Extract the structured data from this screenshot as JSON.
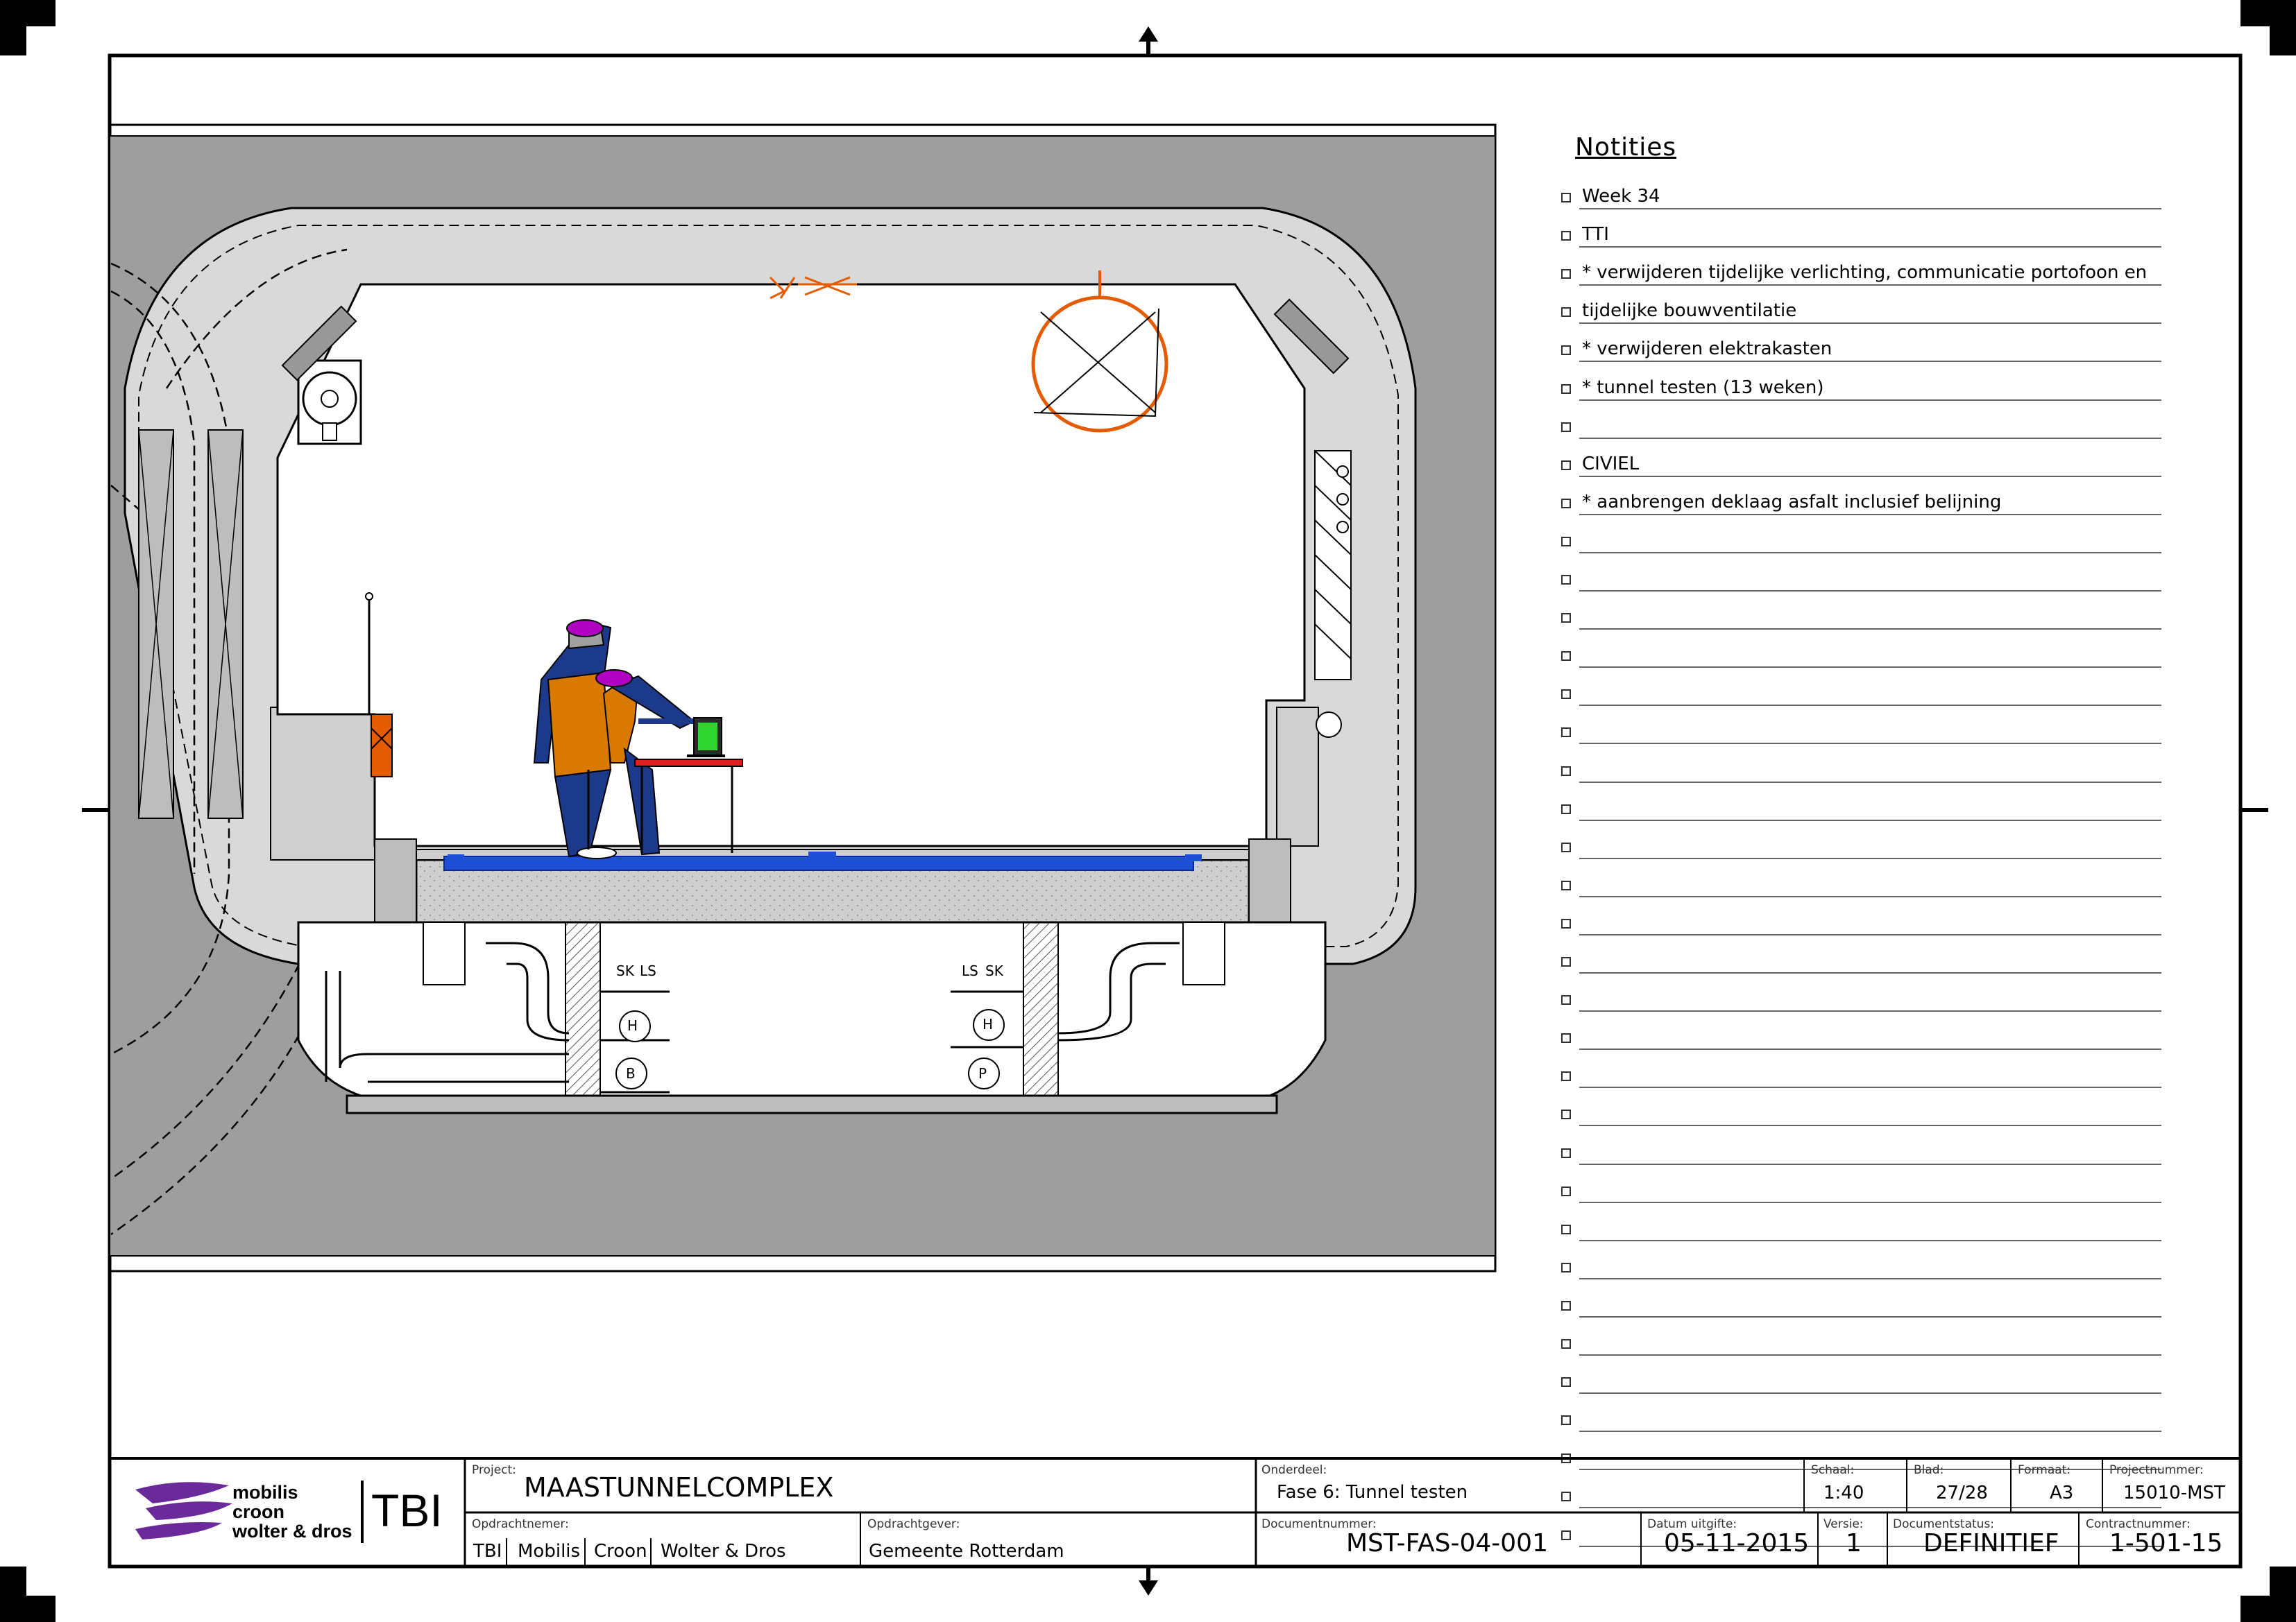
{
  "notes": {
    "title": "Notities",
    "rows": [
      "Week 34",
      "TTI",
      "* verwijderen tijdelijke verlichting, communicatie portofoon en",
      "   tijdelijke bouwventilatie",
      "* verwijderen elektrakasten",
      "* tunnel testen (13 weken)",
      "",
      "CIVIEL",
      "* aanbrengen deklaag asfalt inclusief belijning",
      "",
      "",
      "",
      "",
      "",
      "",
      "",
      "",
      "",
      "",
      "",
      "",
      "",
      "",
      "",
      "",
      "",
      "",
      "",
      "",
      "",
      "",
      "",
      "",
      "",
      "",
      ""
    ]
  },
  "drawing": {
    "pump_labels": [
      "H",
      "B",
      "H",
      "P"
    ],
    "cable_labels": [
      "SK",
      "LS",
      "LS",
      "SK"
    ]
  },
  "titleblock": {
    "logo_lines": [
      "mobilis",
      "croon",
      "wolter & dros"
    ],
    "logo_tbi": "TBI",
    "project_label": "Project:",
    "project": "MAASTUNNELCOMPLEX",
    "onderdeel_label": "Onderdeel:",
    "onderdeel": "Fase 6: Tunnel testen",
    "schaal_label": "Schaal:",
    "schaal": "1:40",
    "blad_label": "Blad:",
    "blad": "27/28",
    "formaat_label": "Formaat:",
    "formaat": "A3",
    "projectnummer_label": "Projectnummer:",
    "projectnummer": "15010-MST",
    "opdrachtnemer_label": "Opdrachtnemer:",
    "opdrachtnemer": [
      "TBI",
      "Mobilis",
      "Croon",
      "Wolter & Dros"
    ],
    "opdrachtgever_label": "Opdrachtgever:",
    "opdrachtgever": "Gemeente Rotterdam",
    "documentnummer_label": "Documentnummer:",
    "documentnummer": "MST-FAS-04-001",
    "datum_label": "Datum uitgifte:",
    "datum": "05-11-2015",
    "versie_label": "Versie:",
    "versie": "1",
    "status_label": "Documentstatus:",
    "status": "DEFINITIEF",
    "contract_label": "Contractnummer:",
    "contract": "1-501-15"
  }
}
